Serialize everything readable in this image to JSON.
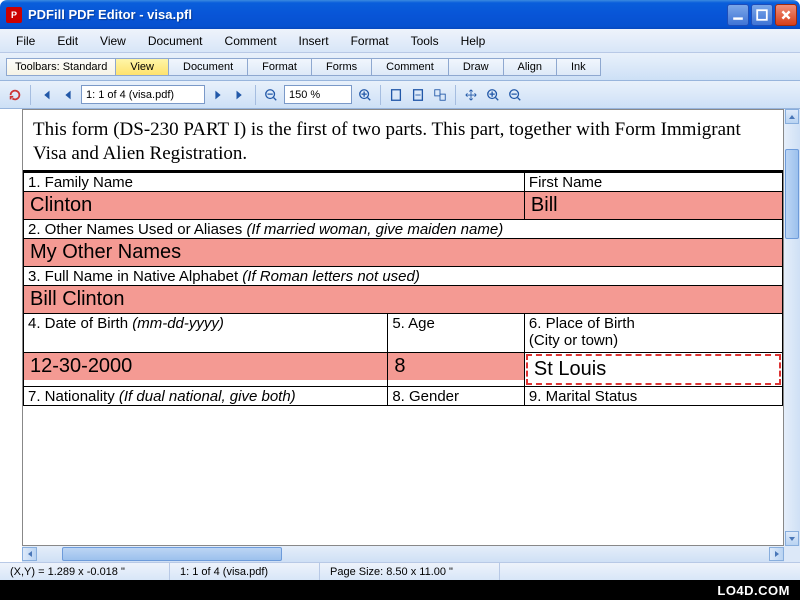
{
  "window": {
    "title": "PDFill PDF Editor - visa.pfl"
  },
  "menu": {
    "items": [
      "File",
      "Edit",
      "View",
      "Document",
      "Comment",
      "Insert",
      "Format",
      "Tools",
      "Help"
    ]
  },
  "toolbar_tabs": {
    "label": "Toolbars: Standard",
    "tabs": [
      "View",
      "Document",
      "Format",
      "Forms",
      "Comment",
      "Draw",
      "Align",
      "Ink"
    ],
    "active": "View"
  },
  "nav": {
    "page_display": "1: 1 of 4 (visa.pdf)",
    "zoom_display": "150 %"
  },
  "document": {
    "header_line": "This form (DS-230 PART I) is the first of two parts.  This part, together with Form Immigrant Visa and Alien Registration.",
    "row1": {
      "family_label": "1. Family Name",
      "first_label": "First Name",
      "family_value": "Clinton",
      "first_value": "Bill"
    },
    "row2": {
      "label": "2. Other Names Used or Aliases ",
      "hint": "(If married woman, give maiden name)",
      "value": "My Other Names"
    },
    "row3": {
      "label": "3. Full Name in Native Alphabet ",
      "hint": "(If Roman letters not used)",
      "value": "Bill Clinton"
    },
    "row4": {
      "dob_label": "4. Date of Birth ",
      "dob_hint": "(mm-dd-yyyy)",
      "dob_value": "12-30-2000",
      "age_label": "5. Age",
      "age_value": "8",
      "pob_label": "6. Place of Birth",
      "pob_sub": "(City or town)",
      "pob_value": "St Louis"
    },
    "row5": {
      "nat_label": "7. Nationality ",
      "nat_hint": "(If dual national, give both)",
      "gender_label": "8. Gender",
      "marital_label": "9. Marital Status"
    }
  },
  "status": {
    "coords": "(X,Y) = 1.289 x -0.018 \"",
    "page": "1: 1 of 4 (visa.pdf)",
    "pagesize": "Page Size: 8.50 x 11.00 \""
  },
  "watermark": "LO4D.COM"
}
